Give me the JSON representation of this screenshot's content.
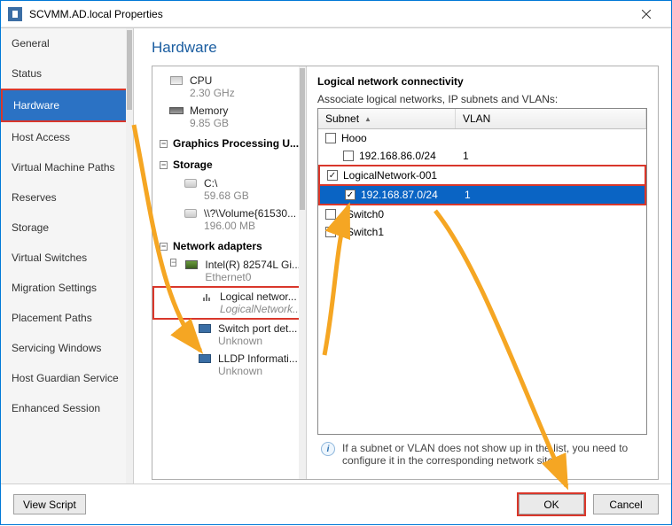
{
  "window": {
    "title": "SCVMM.AD.local Properties",
    "close": "×"
  },
  "sidebar": {
    "items": [
      "General",
      "Status",
      "Hardware",
      "Host Access",
      "Virtual Machine Paths",
      "Reserves",
      "Storage",
      "Virtual Switches",
      "Migration Settings",
      "Placement Paths",
      "Servicing Windows",
      "Host Guardian Service",
      "Enhanced Session"
    ],
    "selected": 2
  },
  "content": {
    "title": "Hardware"
  },
  "tree": {
    "cpu": {
      "label": "CPU",
      "sub": "2.30 GHz"
    },
    "mem": {
      "label": "Memory",
      "sub": "9.85 GB"
    },
    "gfx_section": "Graphics Processing U...",
    "storage_section": "Storage",
    "disk_c": {
      "label": "C:\\",
      "sub": "59.68 GB"
    },
    "disk_v": {
      "label": "\\\\?\\Volume{61530...",
      "sub": "196.00 MB"
    },
    "net_section": "Network adapters",
    "nic": {
      "label": "Intel(R) 82574L Gi...",
      "sub": "Ethernet0"
    },
    "logical": {
      "label": "Logical networ...",
      "sub": "LogicalNetwork..."
    },
    "switchport": {
      "label": "Switch port det...",
      "sub": "Unknown"
    },
    "lldp": {
      "label": "LLDP Informati...",
      "sub": "Unknown"
    }
  },
  "detail": {
    "heading": "Logical network connectivity",
    "assoc": "Associate logical networks, IP subnets and VLANs:",
    "col_subnet": "Subnet",
    "col_vlan": "VLAN",
    "groups": {
      "hooo": {
        "name": "Hooo",
        "checked": false
      },
      "hooo_row": {
        "subnet": "192.168.86.0/24",
        "vlan": "1",
        "checked": false
      },
      "ln001": {
        "name": "LogicalNetwork-001",
        "checked": true
      },
      "ln001_row": {
        "subnet": "192.168.87.0/24",
        "vlan": "1",
        "checked": true
      },
      "vsw0": {
        "name": "vSwitch0",
        "checked": false
      },
      "vsw1": {
        "name": "vSwitch1",
        "checked": false
      }
    },
    "info": "If a subnet or VLAN does not show up in the list, you need to configure it in the corresponding network site."
  },
  "footer": {
    "view_script": "View Script",
    "ok": "OK",
    "cancel": "Cancel"
  }
}
